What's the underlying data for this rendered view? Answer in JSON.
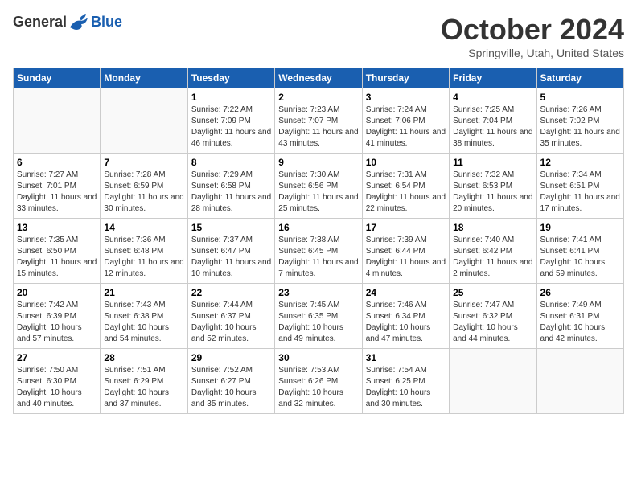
{
  "header": {
    "logo": {
      "general": "General",
      "blue": "Blue"
    },
    "title": "October 2024",
    "location": "Springville, Utah, United States"
  },
  "days_of_week": [
    "Sunday",
    "Monday",
    "Tuesday",
    "Wednesday",
    "Thursday",
    "Friday",
    "Saturday"
  ],
  "weeks": [
    [
      {
        "day": null
      },
      {
        "day": null
      },
      {
        "day": "1",
        "sunrise": "7:22 AM",
        "sunset": "7:09 PM",
        "daylight": "11 hours and 46 minutes."
      },
      {
        "day": "2",
        "sunrise": "7:23 AM",
        "sunset": "7:07 PM",
        "daylight": "11 hours and 43 minutes."
      },
      {
        "day": "3",
        "sunrise": "7:24 AM",
        "sunset": "7:06 PM",
        "daylight": "11 hours and 41 minutes."
      },
      {
        "day": "4",
        "sunrise": "7:25 AM",
        "sunset": "7:04 PM",
        "daylight": "11 hours and 38 minutes."
      },
      {
        "day": "5",
        "sunrise": "7:26 AM",
        "sunset": "7:02 PM",
        "daylight": "11 hours and 35 minutes."
      }
    ],
    [
      {
        "day": "6",
        "sunrise": "7:27 AM",
        "sunset": "7:01 PM",
        "daylight": "11 hours and 33 minutes."
      },
      {
        "day": "7",
        "sunrise": "7:28 AM",
        "sunset": "6:59 PM",
        "daylight": "11 hours and 30 minutes."
      },
      {
        "day": "8",
        "sunrise": "7:29 AM",
        "sunset": "6:58 PM",
        "daylight": "11 hours and 28 minutes."
      },
      {
        "day": "9",
        "sunrise": "7:30 AM",
        "sunset": "6:56 PM",
        "daylight": "11 hours and 25 minutes."
      },
      {
        "day": "10",
        "sunrise": "7:31 AM",
        "sunset": "6:54 PM",
        "daylight": "11 hours and 22 minutes."
      },
      {
        "day": "11",
        "sunrise": "7:32 AM",
        "sunset": "6:53 PM",
        "daylight": "11 hours and 20 minutes."
      },
      {
        "day": "12",
        "sunrise": "7:34 AM",
        "sunset": "6:51 PM",
        "daylight": "11 hours and 17 minutes."
      }
    ],
    [
      {
        "day": "13",
        "sunrise": "7:35 AM",
        "sunset": "6:50 PM",
        "daylight": "11 hours and 15 minutes."
      },
      {
        "day": "14",
        "sunrise": "7:36 AM",
        "sunset": "6:48 PM",
        "daylight": "11 hours and 12 minutes."
      },
      {
        "day": "15",
        "sunrise": "7:37 AM",
        "sunset": "6:47 PM",
        "daylight": "11 hours and 10 minutes."
      },
      {
        "day": "16",
        "sunrise": "7:38 AM",
        "sunset": "6:45 PM",
        "daylight": "11 hours and 7 minutes."
      },
      {
        "day": "17",
        "sunrise": "7:39 AM",
        "sunset": "6:44 PM",
        "daylight": "11 hours and 4 minutes."
      },
      {
        "day": "18",
        "sunrise": "7:40 AM",
        "sunset": "6:42 PM",
        "daylight": "11 hours and 2 minutes."
      },
      {
        "day": "19",
        "sunrise": "7:41 AM",
        "sunset": "6:41 PM",
        "daylight": "10 hours and 59 minutes."
      }
    ],
    [
      {
        "day": "20",
        "sunrise": "7:42 AM",
        "sunset": "6:39 PM",
        "daylight": "10 hours and 57 minutes."
      },
      {
        "day": "21",
        "sunrise": "7:43 AM",
        "sunset": "6:38 PM",
        "daylight": "10 hours and 54 minutes."
      },
      {
        "day": "22",
        "sunrise": "7:44 AM",
        "sunset": "6:37 PM",
        "daylight": "10 hours and 52 minutes."
      },
      {
        "day": "23",
        "sunrise": "7:45 AM",
        "sunset": "6:35 PM",
        "daylight": "10 hours and 49 minutes."
      },
      {
        "day": "24",
        "sunrise": "7:46 AM",
        "sunset": "6:34 PM",
        "daylight": "10 hours and 47 minutes."
      },
      {
        "day": "25",
        "sunrise": "7:47 AM",
        "sunset": "6:32 PM",
        "daylight": "10 hours and 44 minutes."
      },
      {
        "day": "26",
        "sunrise": "7:49 AM",
        "sunset": "6:31 PM",
        "daylight": "10 hours and 42 minutes."
      }
    ],
    [
      {
        "day": "27",
        "sunrise": "7:50 AM",
        "sunset": "6:30 PM",
        "daylight": "10 hours and 40 minutes."
      },
      {
        "day": "28",
        "sunrise": "7:51 AM",
        "sunset": "6:29 PM",
        "daylight": "10 hours and 37 minutes."
      },
      {
        "day": "29",
        "sunrise": "7:52 AM",
        "sunset": "6:27 PM",
        "daylight": "10 hours and 35 minutes."
      },
      {
        "day": "30",
        "sunrise": "7:53 AM",
        "sunset": "6:26 PM",
        "daylight": "10 hours and 32 minutes."
      },
      {
        "day": "31",
        "sunrise": "7:54 AM",
        "sunset": "6:25 PM",
        "daylight": "10 hours and 30 minutes."
      },
      {
        "day": null
      },
      {
        "day": null
      }
    ]
  ],
  "labels": {
    "sunrise": "Sunrise:",
    "sunset": "Sunset:",
    "daylight": "Daylight:"
  }
}
